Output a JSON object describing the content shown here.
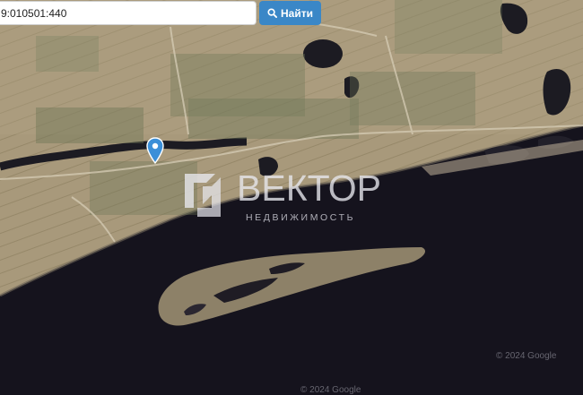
{
  "search": {
    "value": "9:010501:440",
    "button_label": "Найти"
  },
  "watermark": {
    "title": "ВЕКТОР",
    "subtitle": "НЕДВИЖИМОСТЬ"
  },
  "attribution": {
    "text_1": "© 2024 Google",
    "text_2": "© 2024 Google"
  },
  "colors": {
    "river": "#14121c",
    "land": "#a59678",
    "button": "#3a87c7",
    "pin": "#3b8fd8"
  },
  "icons": {
    "search": "search-icon",
    "marker": "map-pin-icon"
  }
}
